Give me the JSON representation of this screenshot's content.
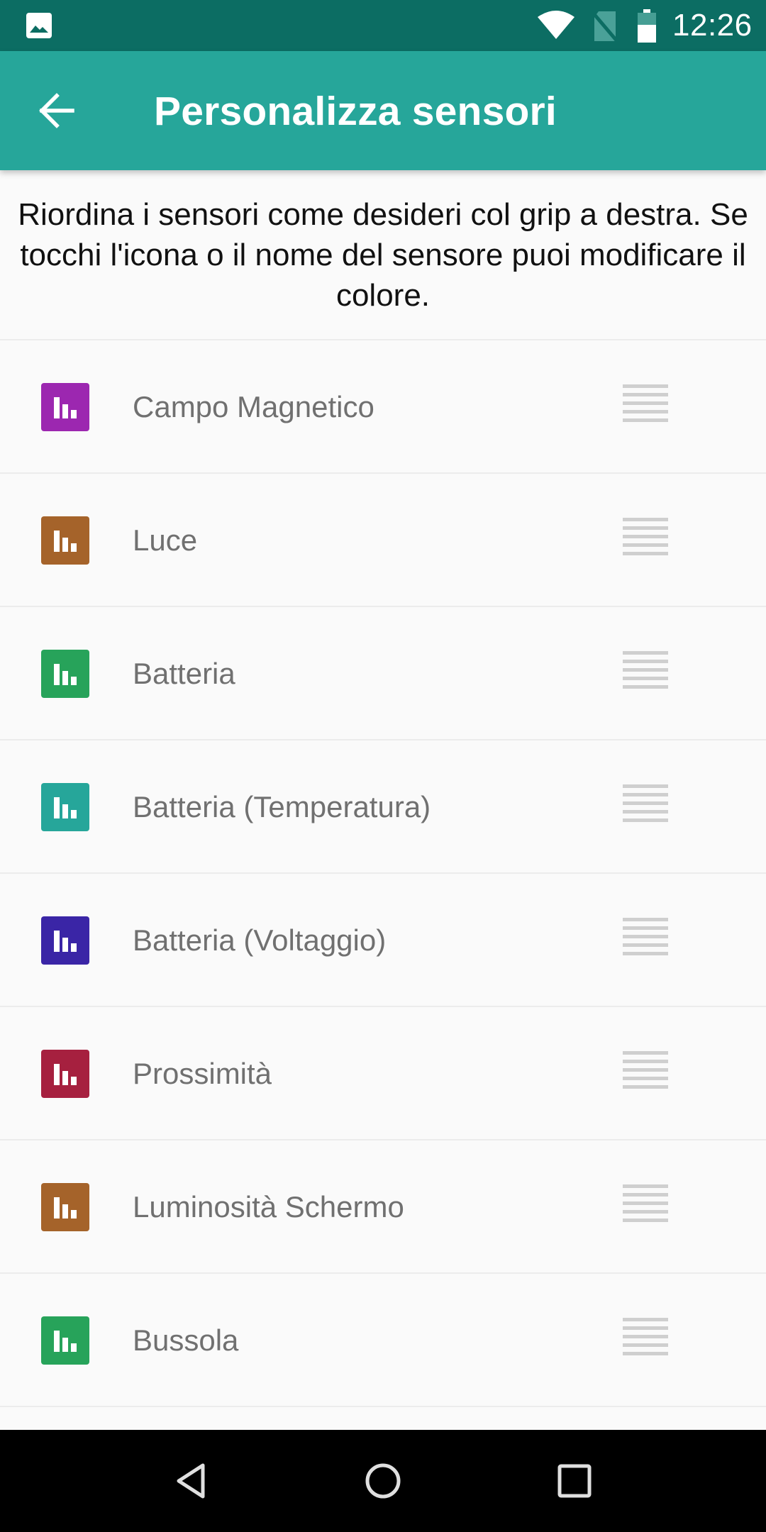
{
  "status_bar": {
    "time": "12:26",
    "icons": [
      "image-icon",
      "wifi-icon",
      "no-sim-icon",
      "battery-icon"
    ]
  },
  "app_bar": {
    "title": "Personalizza sensori",
    "back_icon": "arrow-back-icon"
  },
  "description": "Riordina i sensori come desideri col grip a destra. Se tocchi l'icona o il nome del sensore puoi modificare il colore.",
  "sensors": [
    {
      "name": "Campo Magnetico",
      "color": "#9c27b0"
    },
    {
      "name": "Luce",
      "color": "#a5632a"
    },
    {
      "name": "Batteria",
      "color": "#27a35a"
    },
    {
      "name": "Batteria (Temperatura)",
      "color": "#26a69a"
    },
    {
      "name": "Batteria (Voltaggio)",
      "color": "#3a25a6"
    },
    {
      "name": "Prossimità",
      "color": "#a6203f"
    },
    {
      "name": "Luminosità Schermo",
      "color": "#a5632a"
    },
    {
      "name": "Bussola",
      "color": "#27a35a"
    }
  ],
  "colors": {
    "status_bar": "#0c6d63",
    "app_bar": "#26a69a",
    "background": "#fafafa",
    "grip": "#cfcfcf"
  }
}
